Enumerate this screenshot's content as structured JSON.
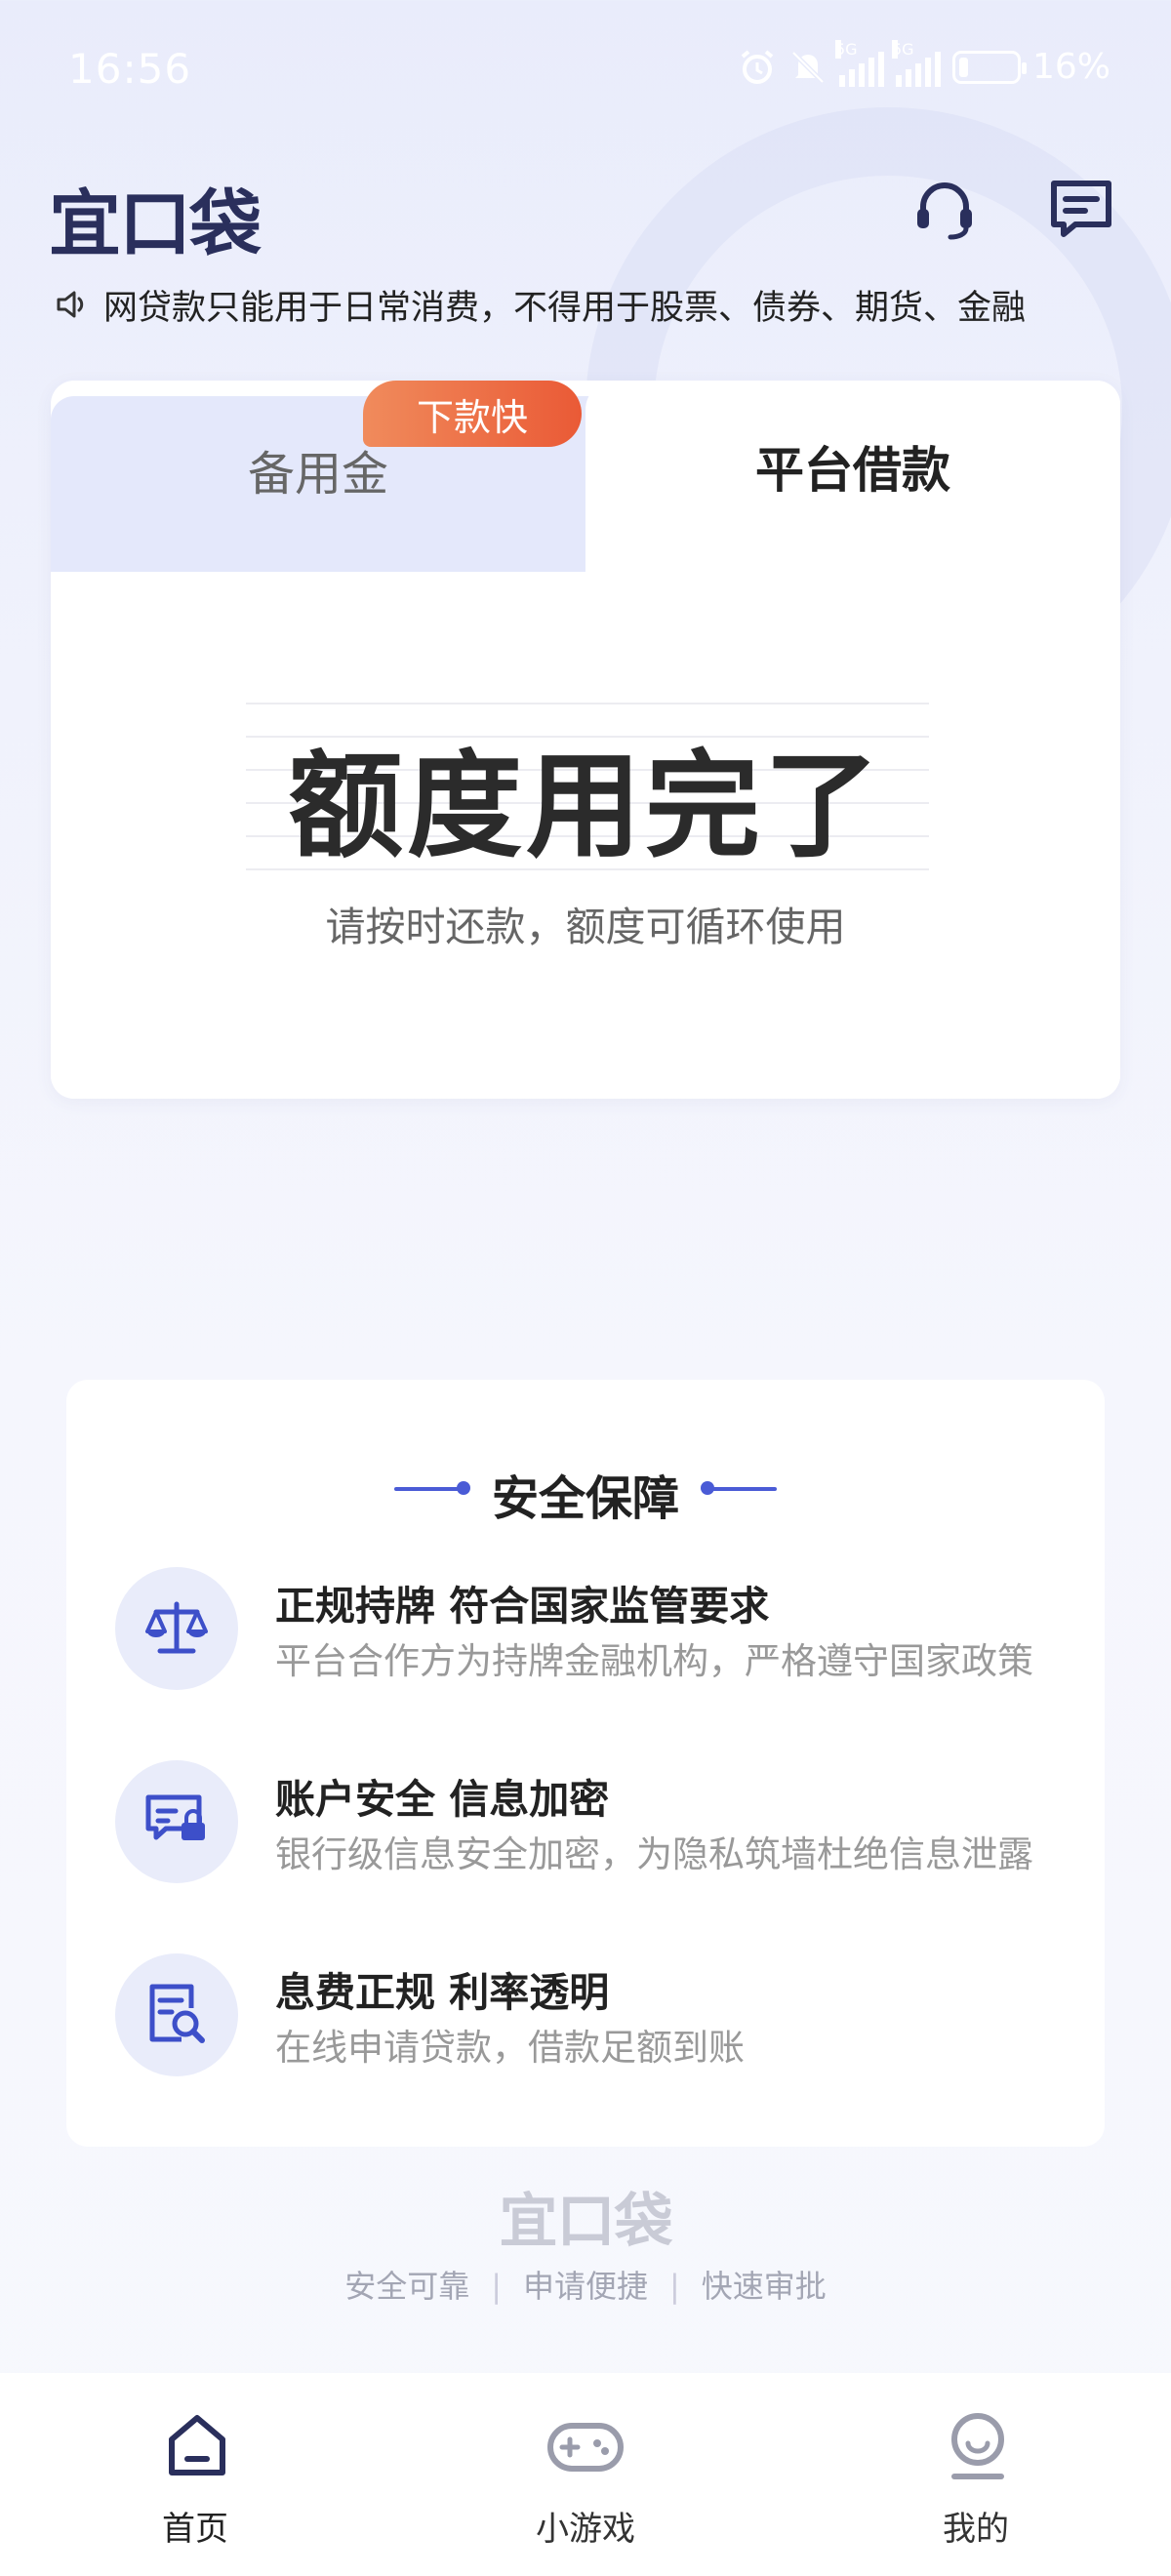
{
  "status_bar": {
    "time": "16:56",
    "battery": "16%",
    "battery_level": 0.16,
    "network_1": "5G",
    "network_2": "5G"
  },
  "header": {
    "logo_text": "宜口袋",
    "support_icon": "headset-icon",
    "message_icon": "message-icon"
  },
  "notice": {
    "icon": "speaker-icon",
    "text": "网贷款只能用于日常消费，不得用于股票、债券、期货、金融"
  },
  "loan_card": {
    "tabs": [
      {
        "label": "备用金",
        "active": false,
        "badge": "下款快"
      },
      {
        "label": "平台借款",
        "active": true
      }
    ],
    "status_title": "额度用完了",
    "status_subtitle": "请按时还款，额度可循环使用"
  },
  "security": {
    "title": "安全保障",
    "features": [
      {
        "icon": "balance-scale-icon",
        "title": "正规持牌 符合国家监管要求",
        "desc": "平台合作方为持牌金融机构，严格遵守国家政策"
      },
      {
        "icon": "secure-message-icon",
        "title": "账户安全 信息加密",
        "desc": "银行级信息安全加密，为隐私筑墙杜绝信息泄露"
      },
      {
        "icon": "document-search-icon",
        "title": "息费正规  利率透明",
        "desc": "在线申请贷款，借款足额到账"
      }
    ]
  },
  "footer": {
    "logo_text": "宜口袋",
    "slogans": [
      "安全可靠",
      "申请便捷",
      "快速审批"
    ],
    "separator": "|"
  },
  "bottom_nav": {
    "items": [
      {
        "label": "首页",
        "icon": "home-icon",
        "active": true
      },
      {
        "label": "小游戏",
        "icon": "gamepad-icon",
        "active": false
      },
      {
        "label": "我的",
        "icon": "profile-icon",
        "active": false
      }
    ]
  },
  "colors": {
    "brand_navy": "#2a2f5c",
    "accent_blue": "#4a5bd6",
    "badge_orange": "#ea5a36",
    "tab_inactive_bg": "#e4e8fb"
  }
}
